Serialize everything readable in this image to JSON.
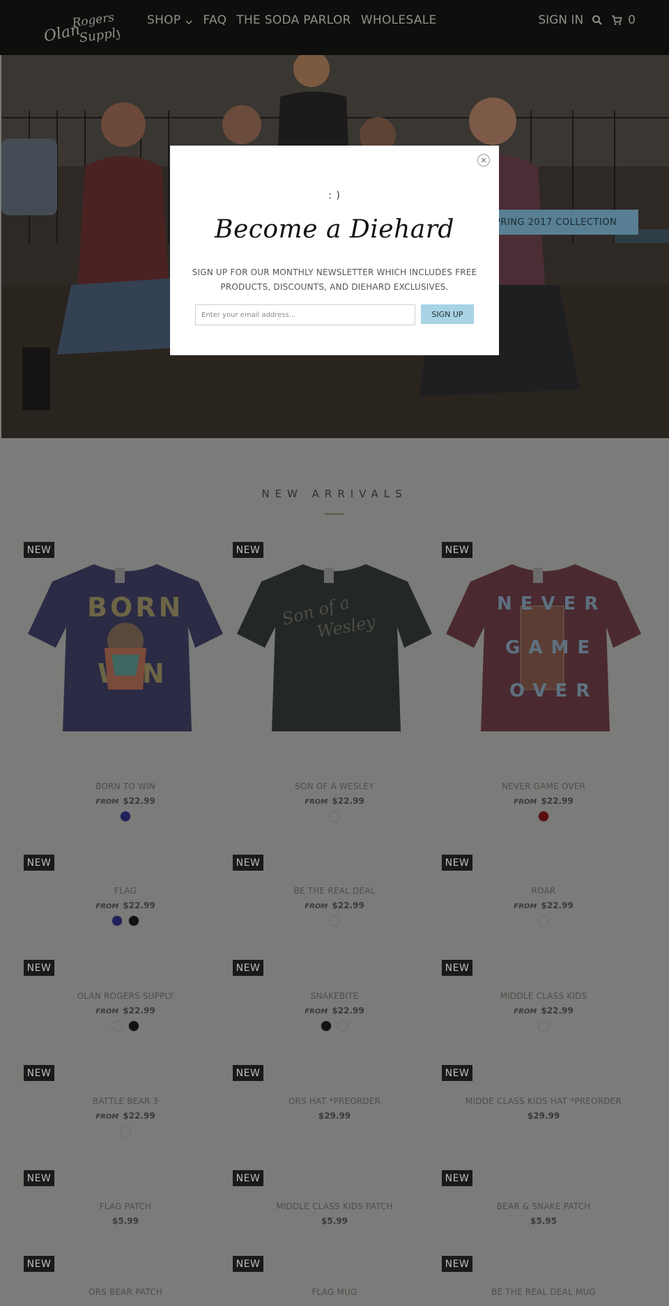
{
  "header": {
    "logo_text": "Olan Rogers Supply",
    "nav": [
      {
        "label": "SHOP",
        "has_dropdown": true
      },
      {
        "label": "FAQ"
      },
      {
        "label": "THE SODA PARLOR"
      },
      {
        "label": "WHOLESALE"
      }
    ],
    "sign_in": "SIGN IN",
    "cart_count": "0"
  },
  "hero": {
    "button_label": "PRING 2017 COLLECTION"
  },
  "section": {
    "title": "NEW ARRIVALS"
  },
  "badge_label": "NEW",
  "from_label": "FROM",
  "products": [
    {
      "name": "BORN TO WIN",
      "from": true,
      "price": "$22.99",
      "swatches": [
        "#23205c"
      ]
    },
    {
      "name": "SON OF A WESLEY",
      "from": true,
      "price": "$22.99",
      "swatches": [
        "#7b7b79"
      ]
    },
    {
      "name": "NEVER GAME OVER",
      "from": true,
      "price": "$22.99",
      "swatches": [
        "#5a0d10"
      ]
    },
    {
      "name": "FLAG",
      "from": true,
      "price": "$22.99",
      "swatches": [
        "#23205c",
        "#111111"
      ]
    },
    {
      "name": "BE THE REAL DEAL",
      "from": true,
      "price": "$22.99",
      "swatches": [
        "#7b7b79"
      ]
    },
    {
      "name": "ROAR",
      "from": true,
      "price": "$22.99",
      "swatches": [
        "#7b7b79"
      ]
    },
    {
      "name": "OLAN ROGERS SUPPLY",
      "from": true,
      "price": "$22.99",
      "swatches": [
        "#7b7b79",
        "#111111"
      ]
    },
    {
      "name": "SNAKEBITE",
      "from": true,
      "price": "$22.99",
      "swatches": [
        "#111111",
        "#7b7b79"
      ]
    },
    {
      "name": "MIDDLE CLASS KIDS",
      "from": true,
      "price": "$22.99",
      "swatches": [
        "#7b7b79"
      ]
    },
    {
      "name": "BATTLE BEAR 3",
      "from": true,
      "price": "$22.99",
      "swatches": [
        "#7b7b79"
      ]
    },
    {
      "name": "ORS HAT *PREORDER",
      "from": false,
      "price": "$29.99",
      "swatches": []
    },
    {
      "name": "MIDDE CLASS KIDS HAT *PREORDER",
      "from": false,
      "price": "$29.99",
      "swatches": []
    },
    {
      "name": "FLAG PATCH",
      "from": false,
      "price": "$5.99",
      "swatches": []
    },
    {
      "name": "MIDDLE CLASS KIDS PATCH",
      "from": false,
      "price": "$5.99",
      "swatches": []
    },
    {
      "name": "BEAR & SNAKE PATCH",
      "from": false,
      "price": "$5.95",
      "swatches": []
    },
    {
      "name": "ORS BEAR PATCH",
      "from": false,
      "price": "",
      "swatches": []
    },
    {
      "name": "FLAG MUG",
      "from": false,
      "price": "",
      "swatches": []
    },
    {
      "name": "BE THE REAL DEAL MUG",
      "from": false,
      "price": "",
      "swatches": []
    }
  ],
  "modal": {
    "smile": ": )",
    "title": "Become a Diehard",
    "text": "SIGN UP FOR OUR MONTHLY NEWSLETTER WHICH INCLUDES FREE PRODUCTS, DISCOUNTS, AND DIEHARD EXCLUSIVES.",
    "input_placeholder": "Enter your email address...",
    "submit_label": "SIGN UP"
  },
  "colors": {
    "header_bg": "#0e0e0d",
    "page_overlay": "#7b7b79",
    "signup_button": "#a7d3e4",
    "hero_button": "#587f93"
  }
}
